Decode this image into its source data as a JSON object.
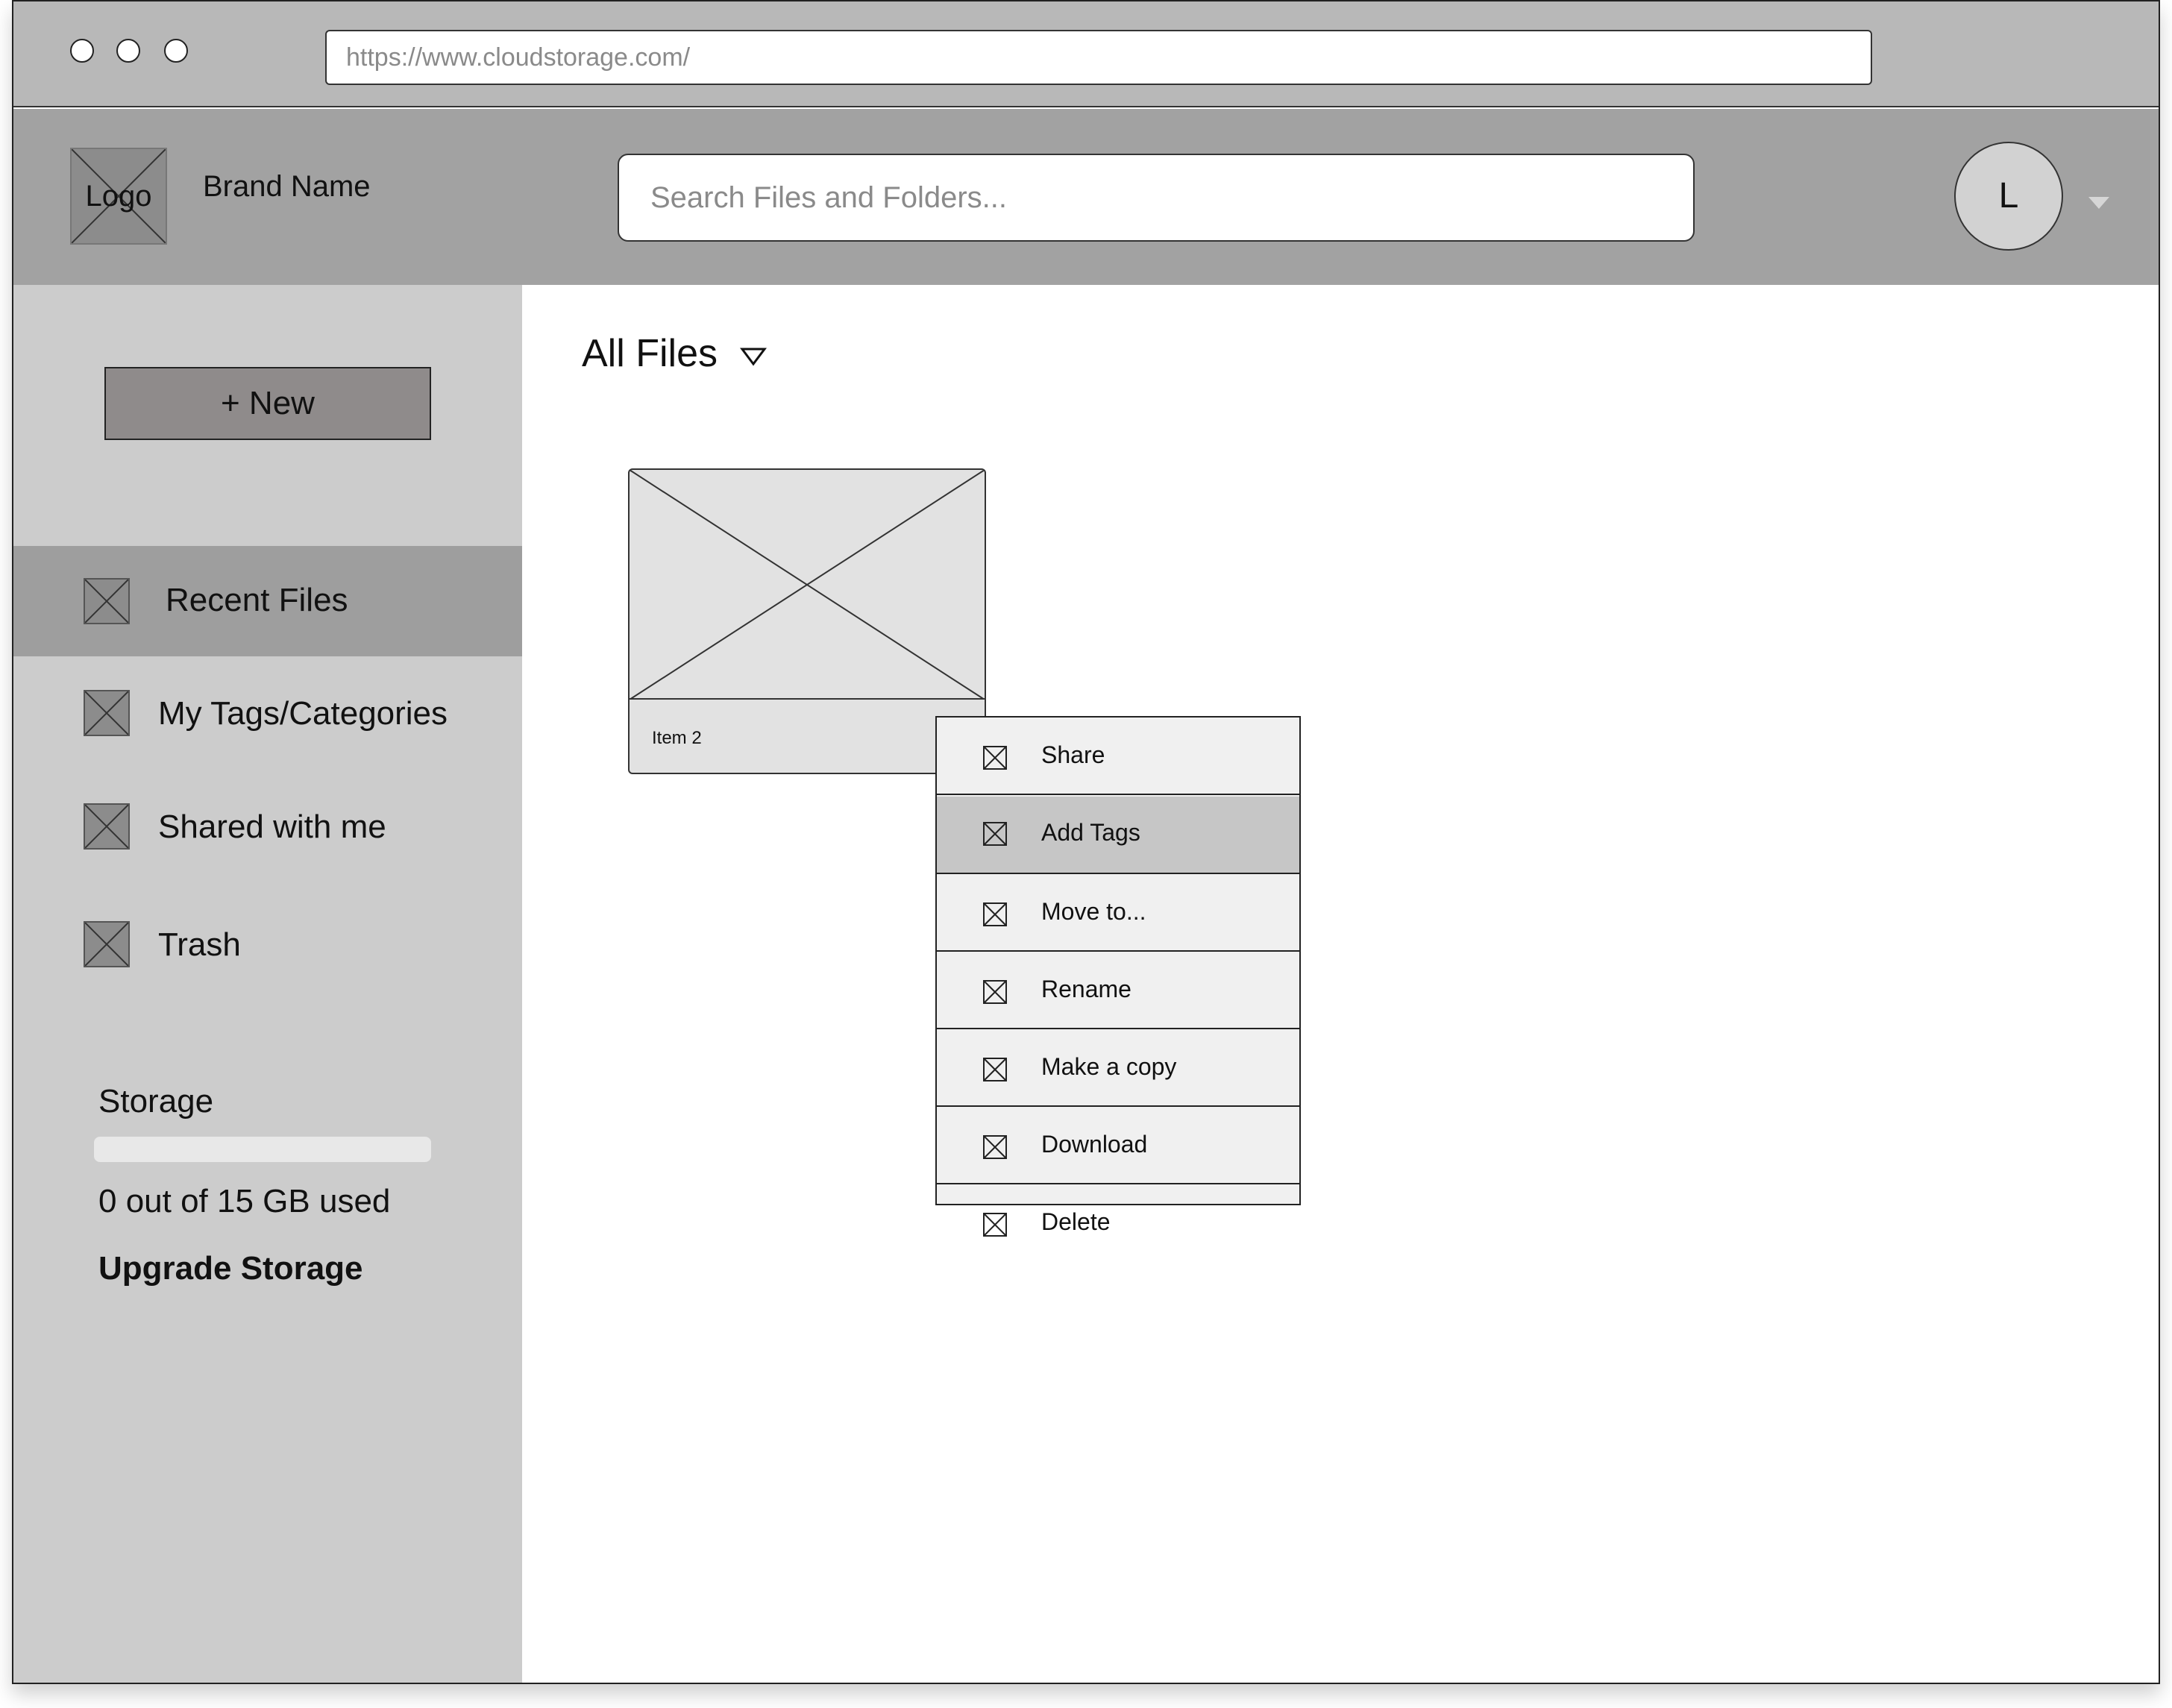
{
  "browser": {
    "url": "https://www.cloudstorage.com/"
  },
  "header": {
    "logo_label": "Logo",
    "brand_name": "Brand Name",
    "search_placeholder": "Search Files and Folders...",
    "avatar_initial": "L"
  },
  "sidebar": {
    "new_button_label": "+ New",
    "items": [
      {
        "label": "Recent Files",
        "active": true
      },
      {
        "label": "My Tags/Categories",
        "active": false
      },
      {
        "label": "Shared with me",
        "active": false
      },
      {
        "label": "Trash",
        "active": false
      }
    ],
    "storage": {
      "title": "Storage",
      "used_fraction": 0,
      "used_text": "0 out of 15 GB used",
      "upgrade_label": "Upgrade Storage"
    }
  },
  "main": {
    "title": "All Files",
    "files": [
      {
        "name": "Item 2"
      }
    ]
  },
  "context_menu": {
    "highlighted_index": 1,
    "items": [
      {
        "label": "Share"
      },
      {
        "label": "Add Tags"
      },
      {
        "label": "Move to..."
      },
      {
        "label": "Rename"
      },
      {
        "label": "Make a copy"
      },
      {
        "label": "Download"
      },
      {
        "label": "Delete"
      }
    ]
  },
  "colors": {
    "browser_bar": "#b8b8b8",
    "app_header": "#a2a2a2",
    "sidebar": "#cccccc",
    "active_nav": "#9e9e9e",
    "menu_highlight": "#c6c6c6"
  }
}
